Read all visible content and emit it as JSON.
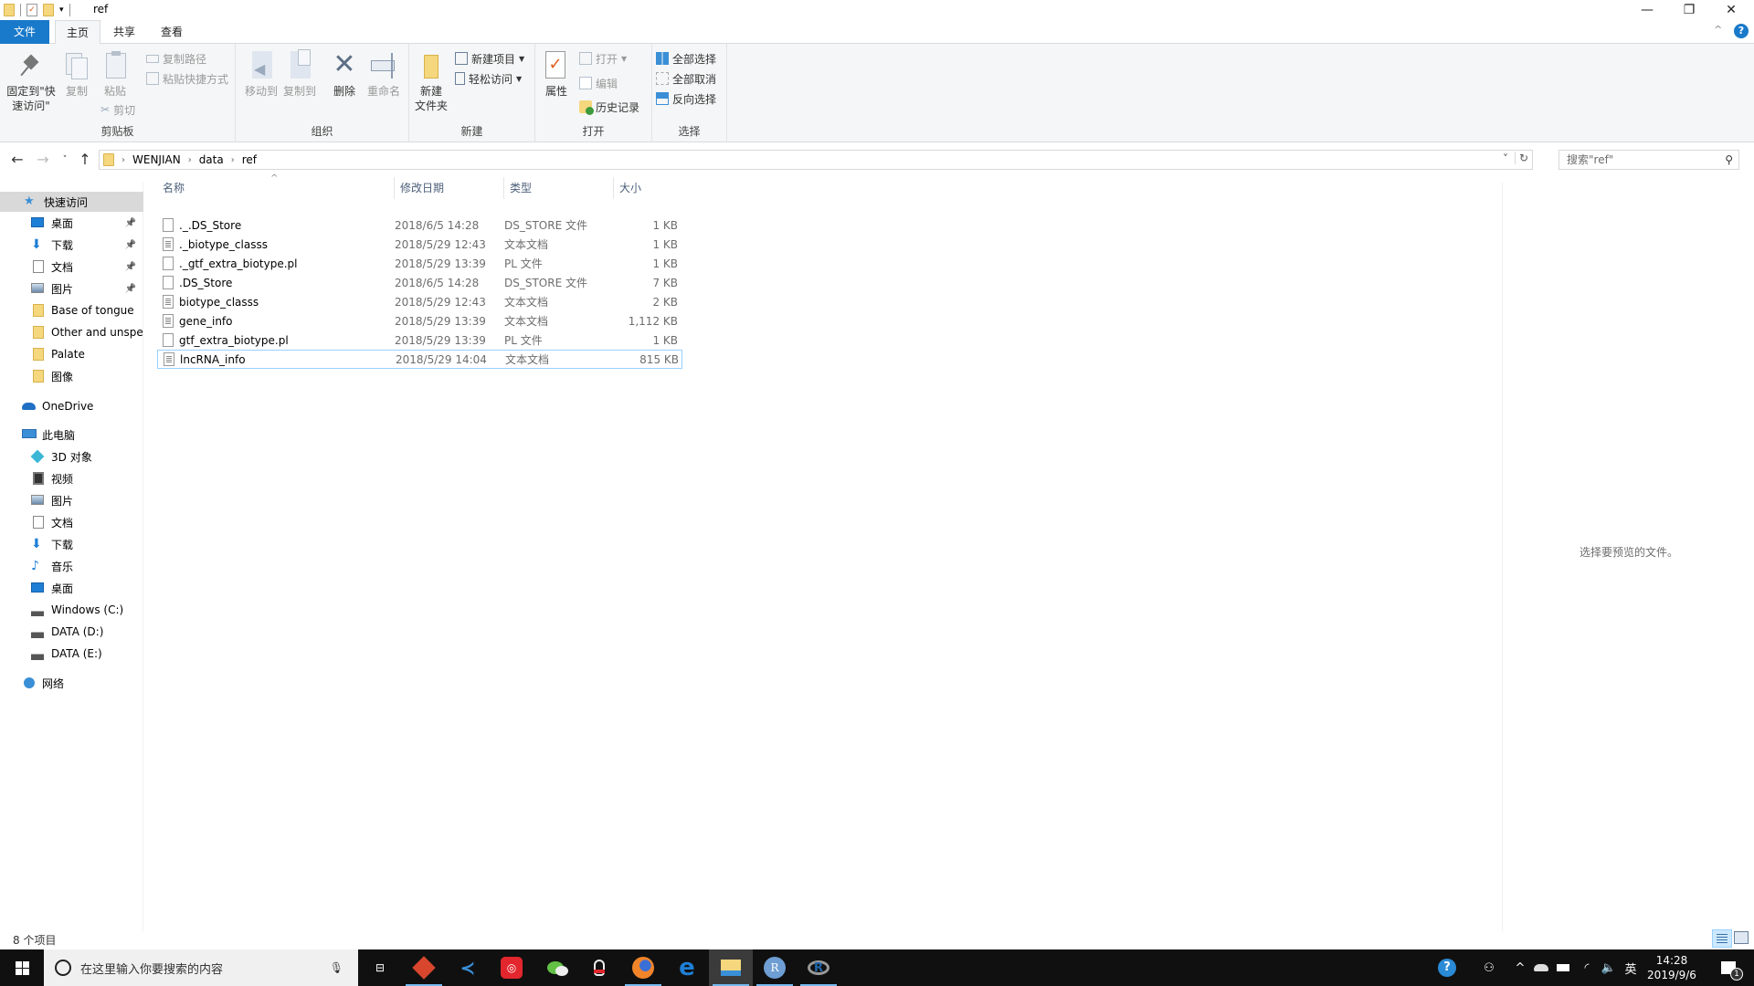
{
  "window": {
    "title": "ref",
    "controls": {
      "minimize": "—",
      "restore": "❐",
      "close": "✕"
    },
    "help_glyph": "?",
    "collapse_ribbon_glyph": "^"
  },
  "tabs": [
    {
      "label": "文件"
    },
    {
      "label": "主页"
    },
    {
      "label": "共享"
    },
    {
      "label": "查看"
    }
  ],
  "ribbon": {
    "clipboard": {
      "label": "剪贴板",
      "pin_quick_access": "固定到\"快速访问\"",
      "copy": "复制",
      "paste": "粘贴",
      "copy_path": "复制路径",
      "paste_shortcut": "粘贴快捷方式",
      "cut": "剪切"
    },
    "organize": {
      "label": "组织",
      "move_to": "移动到",
      "copy_to": "复制到",
      "delete": "删除",
      "rename": "重命名"
    },
    "new": {
      "label": "新建",
      "new_folder": "新建\n文件夹",
      "new_item": "新建项目",
      "easy_access": "轻松访问"
    },
    "open": {
      "label": "打开",
      "properties": "属性",
      "open": "打开",
      "edit": "编辑",
      "history": "历史记录"
    },
    "select": {
      "label": "选择",
      "select_all": "全部选择",
      "select_none": "全部取消",
      "invert": "反向选择"
    }
  },
  "address": {
    "breadcrumb": [
      "WENJIAN",
      "data",
      "ref"
    ],
    "search_placeholder": "搜索\"ref\""
  },
  "nav": {
    "quick_access": "快速访问",
    "quick_items": [
      {
        "label": "桌面",
        "icon": "desktop-icon",
        "pinned": true
      },
      {
        "label": "下载",
        "icon": "download-icon",
        "pinned": true
      },
      {
        "label": "文档",
        "icon": "document-icon",
        "pinned": true
      },
      {
        "label": "图片",
        "icon": "pictures-icon",
        "pinned": true
      },
      {
        "label": "Base of tongue",
        "icon": "folder-icon",
        "pinned": false
      },
      {
        "label": "Other and unspec",
        "icon": "folder-icon",
        "pinned": false
      },
      {
        "label": "Palate",
        "icon": "folder-icon",
        "pinned": false
      },
      {
        "label": "图像",
        "icon": "folder-icon",
        "pinned": false
      }
    ],
    "onedrive": "OneDrive",
    "this_pc": "此电脑",
    "pc_items": [
      {
        "label": "3D 对象",
        "icon": "3d-objects-icon"
      },
      {
        "label": "视频",
        "icon": "video-icon"
      },
      {
        "label": "图片",
        "icon": "pictures-icon"
      },
      {
        "label": "文档",
        "icon": "document-icon"
      },
      {
        "label": "下载",
        "icon": "download-icon"
      },
      {
        "label": "音乐",
        "icon": "music-icon"
      },
      {
        "label": "桌面",
        "icon": "desktop-icon"
      },
      {
        "label": "Windows (C:)",
        "icon": "windows-drive-icon"
      },
      {
        "label": "DATA (D:)",
        "icon": "drive-icon"
      },
      {
        "label": "DATA (E:)",
        "icon": "drive-icon"
      }
    ],
    "network": "网络"
  },
  "file_list": {
    "columns": [
      "名称",
      "修改日期",
      "类型",
      "大小"
    ],
    "sort_indicator": "^",
    "rows": [
      {
        "name": "._.DS_Store",
        "date": "2018/6/5 14:28",
        "type": "DS_STORE 文件",
        "size": "1 KB",
        "icon": "blank"
      },
      {
        "name": "._biotype_classs",
        "date": "2018/5/29 12:43",
        "type": "文本文档",
        "size": "1 KB",
        "icon": "text"
      },
      {
        "name": "._gtf_extra_biotype.pl",
        "date": "2018/5/29 13:39",
        "type": "PL 文件",
        "size": "1 KB",
        "icon": "blank"
      },
      {
        "name": ".DS_Store",
        "date": "2018/6/5 14:28",
        "type": "DS_STORE 文件",
        "size": "7 KB",
        "icon": "blank"
      },
      {
        "name": "biotype_classs",
        "date": "2018/5/29 12:43",
        "type": "文本文档",
        "size": "2 KB",
        "icon": "text"
      },
      {
        "name": "gene_info",
        "date": "2018/5/29 13:39",
        "type": "文本文档",
        "size": "1,112 KB",
        "icon": "text"
      },
      {
        "name": "gtf_extra_biotype.pl",
        "date": "2018/5/29 13:39",
        "type": "PL 文件",
        "size": "1 KB",
        "icon": "blank"
      },
      {
        "name": "lncRNA_info",
        "date": "2018/5/29 14:04",
        "type": "文本文档",
        "size": "815 KB",
        "icon": "text"
      }
    ]
  },
  "preview": {
    "message": "选择要预览的文件。"
  },
  "status": {
    "item_count": "8 个项目"
  },
  "taskbar": {
    "search_placeholder": "在这里输入你要搜索的内容",
    "apps": [
      "task-view",
      "game-app",
      "blue-arrow-app",
      "netease-music",
      "wechat",
      "qq",
      "firefox",
      "edge",
      "file-explorer",
      "r-gui",
      "rstudio"
    ],
    "active_app": "file-explorer",
    "tray": {
      "ime": "英",
      "time": "14:28",
      "date": "2019/9/6",
      "notification_count": "1"
    }
  }
}
